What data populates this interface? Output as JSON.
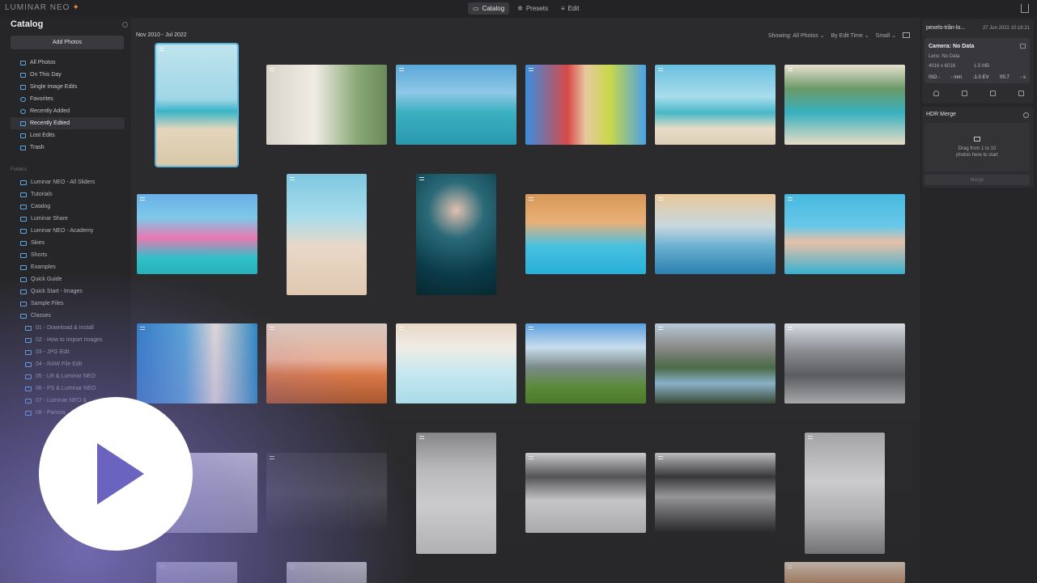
{
  "app": {
    "logo": "LUMINAR NEO",
    "logo_badge": "✦"
  },
  "modes": [
    {
      "label": "Catalog",
      "active": true
    },
    {
      "label": "Presets",
      "active": false
    },
    {
      "label": "Edit",
      "active": false
    }
  ],
  "sidebar": {
    "title": "Catalog",
    "add_label": "Add Photos",
    "items": [
      {
        "label": "All Photos",
        "active": false
      },
      {
        "label": "On This Day",
        "active": false
      },
      {
        "label": "Single Image Edits",
        "active": false
      },
      {
        "label": "Favorites",
        "active": false
      },
      {
        "label": "Recently Added",
        "active": false
      },
      {
        "label": "Recently Edited",
        "active": true
      },
      {
        "label": "Lost Edits",
        "active": false
      },
      {
        "label": "Trash",
        "active": false
      }
    ],
    "folders_label": "Folders",
    "folders": [
      {
        "label": "Luminar NEO - All Sliders",
        "sub": false
      },
      {
        "label": "Tutorials",
        "sub": false
      },
      {
        "label": "Catalog",
        "sub": false
      },
      {
        "label": "Luminar Share",
        "sub": false
      },
      {
        "label": "Luminar NEO - Academy",
        "sub": false
      },
      {
        "label": "Skies",
        "sub": false
      },
      {
        "label": "Shorts",
        "sub": false
      },
      {
        "label": "Examples",
        "sub": false
      },
      {
        "label": "Quick Guide",
        "sub": false
      },
      {
        "label": "Quick Start - Images",
        "sub": false
      },
      {
        "label": "Sample Files",
        "sub": false
      },
      {
        "label": "Classes",
        "sub": false
      },
      {
        "label": "01 - Download & Install",
        "sub": true
      },
      {
        "label": "02 - How to Import Images",
        "sub": true
      },
      {
        "label": "03 - JPG Edit",
        "sub": true
      },
      {
        "label": "04 - RAW File Edit",
        "sub": true
      },
      {
        "label": "05 - LR & Luminar NEO",
        "sub": true
      },
      {
        "label": "06 - PS & Luminar NEO",
        "sub": true
      },
      {
        "label": "07 - Luminar NEO & ...",
        "sub": true
      },
      {
        "label": "08 - Panora...",
        "sub": true
      }
    ]
  },
  "toolbar": {
    "date_range": "Nov 2010 - Jul 2022",
    "showing": "Showing: All Photos",
    "sort": "By Edit Time",
    "size": "Small"
  },
  "info": {
    "filename": "pexels-trần-lo...",
    "date": "27 Jun 2022 10:18:21",
    "camera": "Camera: No Data",
    "lens": "Lens: No Data",
    "dims": "4016 x 6016",
    "filesize": "1.5 MB",
    "iso": "ISO -",
    "focal": "- mm",
    "ev": "-1.0 EV",
    "aperture": "f/0.7",
    "shutter": "- s"
  },
  "hdr": {
    "title": "HDR Merge",
    "drop_line1": "Drag from 1 to 10",
    "drop_line2": "photos here to start",
    "merge_label": "Merge"
  },
  "colors": {
    "accent": "#5ab8e0",
    "play_triangle": "#6a64c0",
    "overlay": "#8a80dc"
  }
}
